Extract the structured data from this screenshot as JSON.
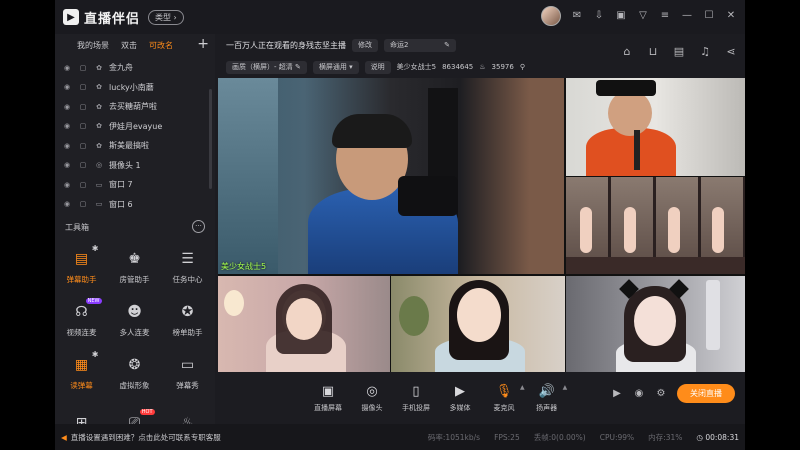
{
  "titlebar": {
    "app_name": "直播伴侣",
    "type_button": "类型",
    "icons": [
      "avatar",
      "mail-icon",
      "download-icon",
      "screen-icon",
      "filter-icon",
      "menu-icon",
      "minimize-icon",
      "maximize-icon",
      "close-icon"
    ]
  },
  "sidebar": {
    "tabs": [
      "我的场景",
      "双击",
      "可改名"
    ],
    "active_tab": "可改名",
    "scenes": [
      {
        "label": "金九舟",
        "type": "media"
      },
      {
        "label": "lucky小南蘑",
        "type": "media"
      },
      {
        "label": "去买糖葫芦啦",
        "type": "media"
      },
      {
        "label": "伊娃月evayue",
        "type": "media"
      },
      {
        "label": "斯美最搞啦",
        "type": "media"
      },
      {
        "label": "摄像头 1",
        "type": "camera"
      },
      {
        "label": "窗口 7",
        "type": "window"
      },
      {
        "label": "窗口 6",
        "type": "window"
      }
    ],
    "tools_title": "工具箱",
    "tools": [
      {
        "label": "弹幕助手",
        "icon": "danmu-icon",
        "active": true,
        "badge": "gear"
      },
      {
        "label": "房管助手",
        "icon": "admin-icon"
      },
      {
        "label": "任务中心",
        "icon": "task-icon"
      },
      {
        "label": "视频连麦",
        "icon": "video-link-icon",
        "badge": "new"
      },
      {
        "label": "多人连麦",
        "icon": "multi-link-icon"
      },
      {
        "label": "榜单助手",
        "icon": "rank-icon"
      },
      {
        "label": "读弹幕",
        "icon": "read-danmu-icon",
        "active": true,
        "badge": "gear"
      },
      {
        "label": "虚拟形象",
        "icon": "avatar-icon"
      },
      {
        "label": "弹幕秀",
        "icon": "danmu-show-icon"
      },
      {
        "label": "",
        "icon": "more-tool-1-icon"
      },
      {
        "label": "",
        "icon": "more-tool-2-icon",
        "badge": "hot"
      },
      {
        "label": "",
        "icon": "fire-icon"
      }
    ]
  },
  "main": {
    "title": "一百万人正在观看的身残志坚主播",
    "edit_label": "修改",
    "category": "命运2",
    "quality_label": "画质（横屏）- 超清",
    "landscape_label": "横屏通用",
    "explain_label": "说明",
    "host_name": "美少女战士5",
    "room_id": "8634645",
    "likes": "35976",
    "cam_label_main": "美少女战士5"
  },
  "bottombar": {
    "items": [
      {
        "label": "直播屏幕",
        "icon": "screen-live-icon"
      },
      {
        "label": "摄像头",
        "icon": "camera-icon"
      },
      {
        "label": "手机投屏",
        "icon": "phone-cast-icon"
      },
      {
        "label": "多媒体",
        "icon": "media-icon"
      },
      {
        "label": "麦克风",
        "icon": "mic-icon",
        "caret": true
      },
      {
        "label": "扬声器",
        "icon": "speaker-icon",
        "caret": true
      }
    ],
    "close_live": "关闭直播"
  },
  "statusbar": {
    "notice": "直播设置遇到困难？点击此处可联系专职客服",
    "bitrate": "码率:1051kb/s",
    "fps": "FPS:25",
    "dropped": "丢帧:0(0.00%)",
    "cpu": "CPU:99%",
    "memory": "内存:31%",
    "duration": "00:08:31"
  },
  "colors": {
    "accent": "#ff8c1a",
    "label_green": "#a6ff4d",
    "bg": "#1c1c21"
  }
}
